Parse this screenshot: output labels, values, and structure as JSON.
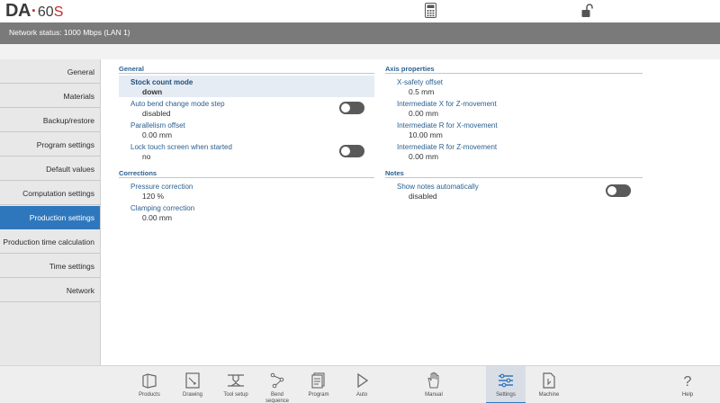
{
  "header": {
    "logo_da": "DA",
    "logo_dot": "·",
    "logo_model": "60",
    "logo_suffix": "S",
    "icons": [
      "calculator-icon",
      "unlock-icon"
    ]
  },
  "status": {
    "network": "Network status: 1000 Mbps (LAN 1)"
  },
  "sidebar": {
    "items": [
      {
        "label": "General"
      },
      {
        "label": "Materials"
      },
      {
        "label": "Backup/restore"
      },
      {
        "label": "Program settings"
      },
      {
        "label": "Default values"
      },
      {
        "label": "Computation settings"
      },
      {
        "label": "Production settings",
        "active": true
      },
      {
        "label": "Production time calculation"
      },
      {
        "label": "Time settings"
      },
      {
        "label": "Network"
      }
    ]
  },
  "sections": {
    "general": {
      "title": "General",
      "settings": [
        {
          "label": "Stock count mode",
          "value": "down"
        },
        {
          "label": "Auto bend change mode step",
          "value": "disabled"
        },
        {
          "label": "Parallelism offset",
          "value": "0.00 mm"
        },
        {
          "label": "Lock touch screen when started",
          "value": "no"
        }
      ]
    },
    "corrections": {
      "title": "Corrections",
      "settings": [
        {
          "label": "Pressure correction",
          "value": "120 %"
        },
        {
          "label": "Clamping correction",
          "value": "0.00 mm"
        }
      ]
    },
    "axis": {
      "title": "Axis properties",
      "settings": [
        {
          "label": "X-safety offset",
          "value": "0.5 mm"
        },
        {
          "label": "Intermediate X for Z-movement",
          "value": "0.00 mm"
        },
        {
          "label": "Intermediate R for X-movement",
          "value": "10.00 mm"
        },
        {
          "label": "Intermediate R for Z-movement",
          "value": "0.00 mm"
        }
      ]
    },
    "notes": {
      "title": "Notes",
      "settings": [
        {
          "label": "Show notes automatically",
          "value": "disabled"
        }
      ]
    }
  },
  "bottom_nav": {
    "products": "Products",
    "drawing": "Drawing",
    "tool_setup": "Tool setup",
    "bend_sequence_1": "Bend",
    "bend_sequence_2": "sequence",
    "program": "Program",
    "auto": "Auto",
    "manual": "Manual",
    "settings": "Settings",
    "machine": "Machine",
    "help": "Help"
  },
  "colors": {
    "accent": "#2f77bc",
    "logo_red": "#c7282b",
    "label_blue": "#2a5f8f",
    "status_bar": "#7a7a7a",
    "toggle_off": "#5a5a5a"
  }
}
